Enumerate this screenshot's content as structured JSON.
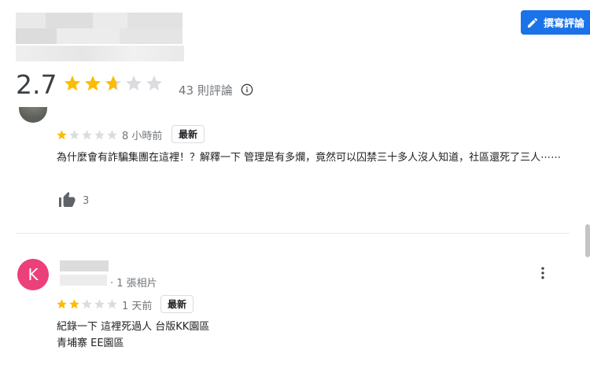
{
  "header": {
    "write_review_label": "撰寫評論",
    "rating": "2.7",
    "rating_value": 2.7,
    "review_count": "43 則評論"
  },
  "reviews": [
    {
      "stars": 1,
      "time": "8 小時前",
      "badge": "最新",
      "text": "為什麼會有詐騙集團在這裡！？解釋一下 管理是有多爛，竟然可以囚禁三十多人沒人知道，社區還死了三人⋯⋯",
      "likes": "3"
    },
    {
      "avatar_letter": "K",
      "photo_count": "· 1 張相片",
      "stars": 2,
      "time": "1 天前",
      "badge": "最新",
      "text_line1": "紀錄一下 這裡死過人 台版KK園區",
      "text_line2": "青埔寨 EE園區"
    }
  ],
  "colors": {
    "accent": "#1a73e8",
    "star": "#fbbc04",
    "star_empty": "#dadce0",
    "avatar_k": "#ec407a"
  },
  "icons": {
    "write": "pencil-icon",
    "info": "info-icon",
    "like": "thumbs-up-icon",
    "more": "more-vert-icon"
  }
}
